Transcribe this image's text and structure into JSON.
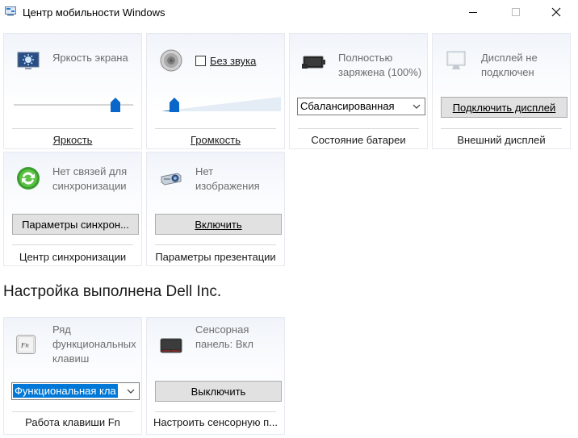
{
  "window": {
    "title": "Центр мобильности Windows",
    "controls": {
      "minimize": "–",
      "maximize": "☐",
      "close": "✕"
    }
  },
  "tiles": {
    "brightness": {
      "label": "Яркость экрана",
      "footer": "Яркость",
      "icon": "display-brightness-icon",
      "slider_value": 0.85
    },
    "volume": {
      "mute_label": "Без звука",
      "mute_checked": false,
      "footer": "Громкость",
      "icon": "speaker-icon",
      "slider_value": 0.08
    },
    "battery": {
      "label": "Полностью заряжена (100%)",
      "plan_selected": "Сбалансированная",
      "footer": "Состояние батареи",
      "icon": "battery-icon",
      "charge_percent": 100
    },
    "external_display": {
      "label": "Дисплей не подключен",
      "button": "Подключить дисплей",
      "footer": "Внешний дисплей",
      "icon": "monitor-icon"
    },
    "sync": {
      "label": "Нет связей для синхронизации",
      "button": "Параметры синхрон...",
      "footer": "Центр синхронизации",
      "icon": "sync-icon"
    },
    "presentation": {
      "label": "Нет изображения",
      "button": "Включить",
      "footer": "Параметры презентации",
      "icon": "projector-icon"
    }
  },
  "vendor_section": {
    "title": "Настройка выполнена Dell Inc.",
    "fn_keys": {
      "label": "Ряд функциональных клавиш",
      "selected": "Функциональная кла",
      "footer": "Работа клавиши Fn",
      "icon": "fn-key-icon",
      "icon_text": "Fn"
    },
    "touchpad": {
      "label": "Сенсорная панель: Вкл",
      "button": "Выключить",
      "footer": "Настроить сенсорную п...",
      "icon": "touchpad-icon"
    }
  },
  "colors": {
    "accent": "#0a66c8",
    "selection": "#0078d7",
    "tile_border": "#e6e9ee"
  }
}
